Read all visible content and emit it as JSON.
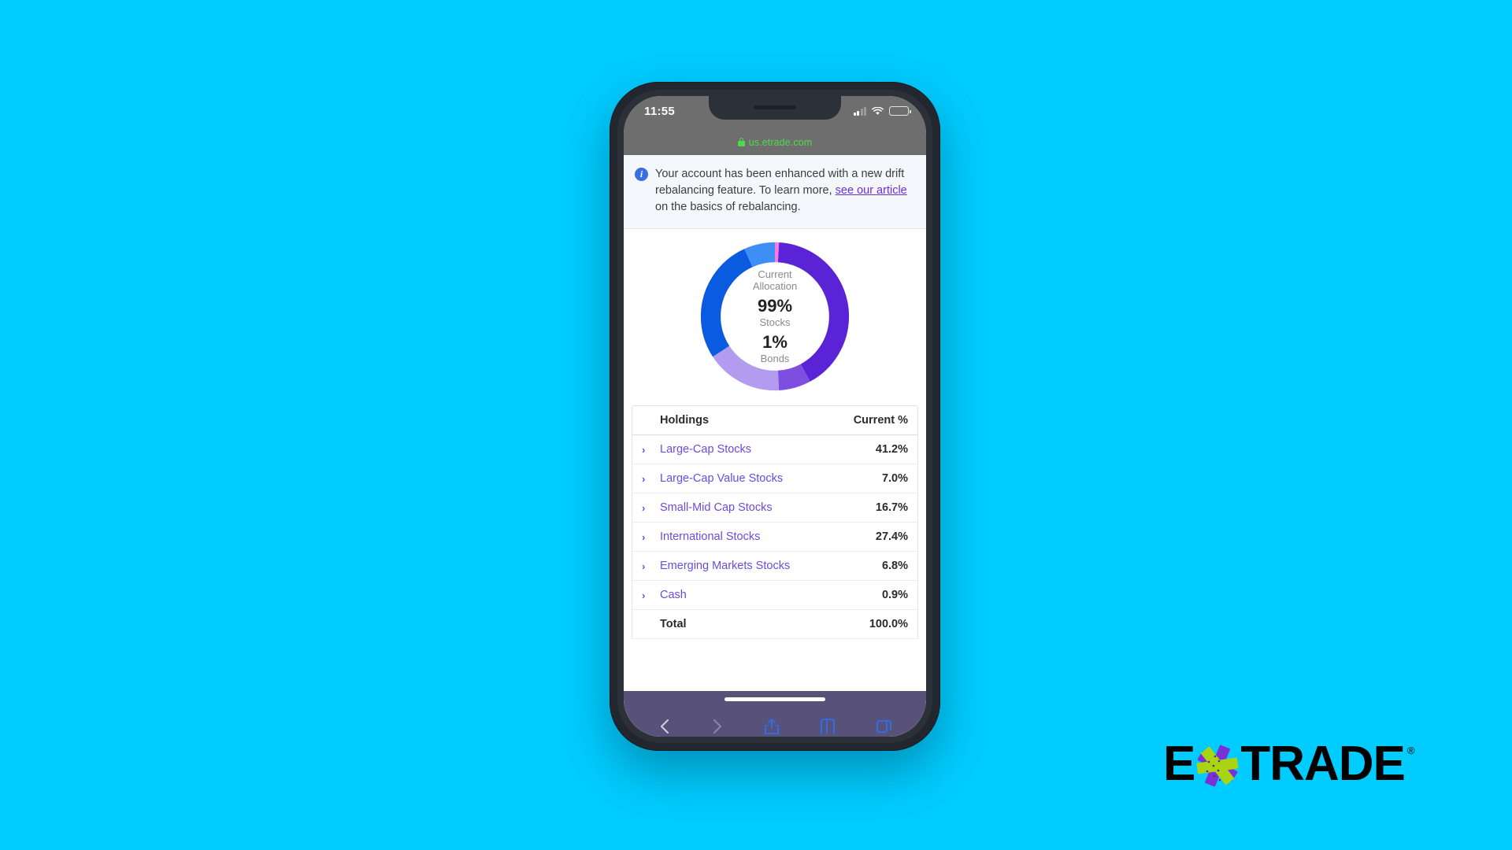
{
  "background_color": "#00ccff",
  "status_bar": {
    "time": "11:55",
    "signal_icon": "cellular-signal-icon",
    "wifi_icon": "wifi-icon",
    "battery_icon": "battery-icon"
  },
  "browser": {
    "lock_icon": "lock-icon",
    "url": "us.etrade.com",
    "url_color": "#4ddb4d",
    "toolbar": {
      "back_label": "Back",
      "forward_label": "Forward",
      "share_label": "Share",
      "bookmarks_label": "Bookmarks",
      "tabs_label": "Tabs"
    }
  },
  "notice": {
    "icon": "info-icon",
    "text_before": "Your account has been enhanced with a new drift rebalancing feature. To learn more, ",
    "link_text": "see our article",
    "text_after": " on the basics of rebalancing."
  },
  "chart_data": {
    "type": "pie",
    "title": "Current Allocation",
    "center_label_line1": "Current",
    "center_label_line2": "Allocation",
    "center_stat_1_value": "99%",
    "center_stat_1_label": "Stocks",
    "center_stat_2_value": "1%",
    "center_stat_2_label": "Bonds",
    "categories": [
      "Cash",
      "Large-Cap Stocks",
      "Large-Cap Value Stocks",
      "Small-Mid Cap Stocks",
      "International Stocks",
      "Emerging Markets Stocks"
    ],
    "values": [
      0.9,
      41.2,
      7.0,
      16.7,
      27.4,
      6.8
    ],
    "colors": [
      "#f97ae0",
      "#5b23d6",
      "#7d4ee0",
      "#b39cf0",
      "#0a5be0",
      "#3d8ef5"
    ],
    "legend_position": "none",
    "grid": false
  },
  "holdings_table": {
    "columns": [
      "Holdings",
      "Current %"
    ],
    "rows": [
      {
        "expand_icon": "chevron-right-icon",
        "name": "Large-Cap Stocks",
        "current_pct": "41.2%"
      },
      {
        "expand_icon": "chevron-right-icon",
        "name": "Large-Cap Value Stocks",
        "current_pct": "7.0%"
      },
      {
        "expand_icon": "chevron-right-icon",
        "name": "Small-Mid Cap Stocks",
        "current_pct": "16.7%"
      },
      {
        "expand_icon": "chevron-right-icon",
        "name": "International Stocks",
        "current_pct": "27.4%"
      },
      {
        "expand_icon": "chevron-right-icon",
        "name": "Emerging Markets Stocks",
        "current_pct": "6.8%"
      },
      {
        "expand_icon": "chevron-right-icon",
        "name": "Cash",
        "current_pct": "0.9%"
      }
    ],
    "total_label": "Total",
    "total_value": "100.0%",
    "link_color": "#6b4be0"
  },
  "brand": {
    "logo_e": "E",
    "logo_star": "asterisk-icon",
    "logo_trade": "TRADE",
    "registered_mark": "®",
    "star_color_purple": "#7b2fd6",
    "star_color_green": "#a8d411"
  }
}
